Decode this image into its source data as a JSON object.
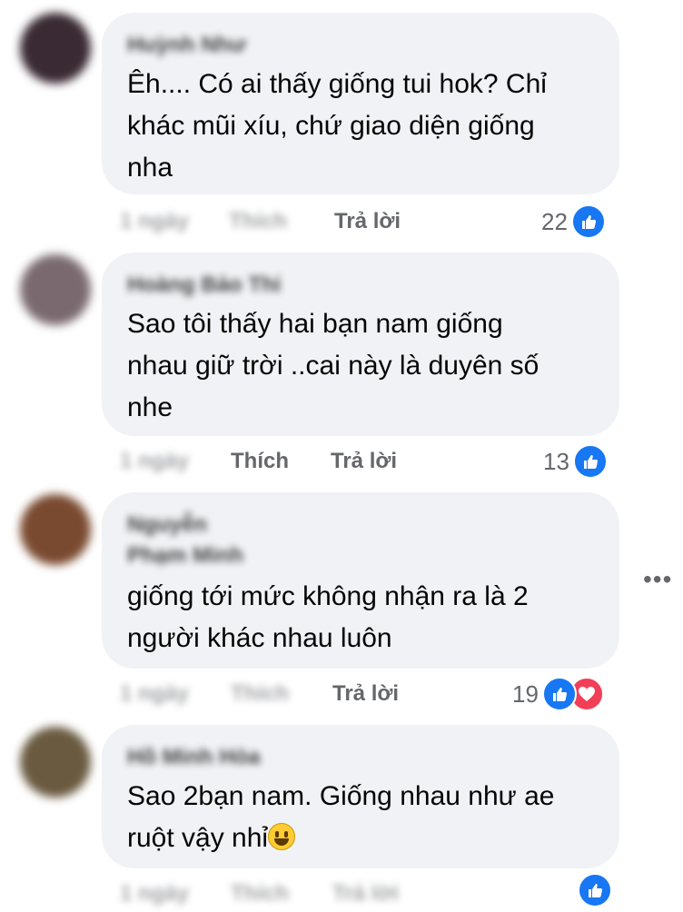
{
  "comments": [
    {
      "name": "Huỳnh Như",
      "text": "Êh.... Có ai thấy giống tui hok? Chỉ\nkhác mũi xíu, chứ giao diện giống\nnha",
      "time": "1 ngày",
      "like_label": "Thích",
      "reply_label": "Trả lời",
      "reaction_count": "22",
      "avatar_color": "#3a2a33"
    },
    {
      "name": "Hoàng Bảo Thi",
      "text": "Sao tôi thấy hai bạn nam giống\nnhau giữ trời ..cai này là duyên số\nnhe",
      "time": "1 ngày",
      "like_label": "Thích",
      "reply_label": "Trả lời",
      "reaction_count": "13",
      "avatar_color": "#7a6a70"
    },
    {
      "name": "Nguyễn",
      "name_line2": "Phạm Minh",
      "text": "giống tới mức không nhận ra là 2\nngười khác nhau luôn",
      "time": "1 ngày",
      "like_label": "Thích",
      "reply_label": "Trả lời",
      "reaction_count": "19",
      "avatar_color": "#7a4a30"
    },
    {
      "name": "Hồ Minh Hòa",
      "text": "Sao 2bạn nam. Giống nhau như ae\nruột vậy nhỉ",
      "time": "1 ngày",
      "like_label": "Thích",
      "reply_label": "Trả lời",
      "reaction_count": "",
      "avatar_color": "#6a5a40"
    }
  ],
  "icons": {
    "like": "thumbs-up-icon",
    "love": "heart-icon",
    "more": "more-options-icon",
    "emoji": "grinning-face-emoji"
  },
  "colors": {
    "bubble": "#f0f2f5",
    "meta_text": "#65676b",
    "like_blue": "#1877f2",
    "love_red": "#f33e58"
  }
}
